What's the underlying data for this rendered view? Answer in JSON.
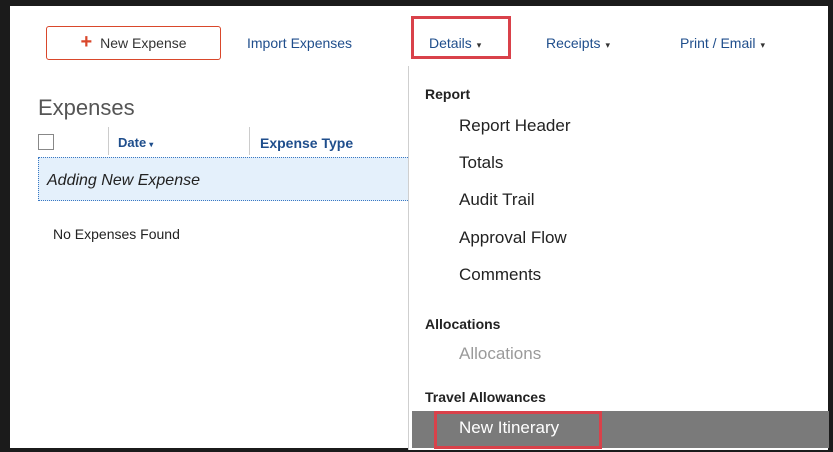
{
  "toolbar": {
    "new_expense_label": "New Expense",
    "new_expense_icon": "plus-icon",
    "import_label": "Import Expenses",
    "details_label": "Details",
    "receipts_label": "Receipts",
    "print_email_label": "Print / Email",
    "caret_glyph": "▾"
  },
  "expenses": {
    "title": "Expenses",
    "columns": {
      "date": "Date",
      "expense_type": "Expense Type"
    },
    "adding_row": "Adding New Expense",
    "empty_message": "No Expenses Found"
  },
  "details_menu": {
    "sections": [
      {
        "label": "Report",
        "items": [
          "Report Header",
          "Totals",
          "Audit Trail",
          "Approval Flow",
          "Comments"
        ]
      },
      {
        "label": "Allocations",
        "items": [
          "Allocations"
        ]
      },
      {
        "label": "Travel Allowances",
        "items": [
          "New Itinerary"
        ]
      }
    ]
  },
  "colors": {
    "accent_red": "#d9472b",
    "highlight_red": "#d9414a",
    "link_blue": "#1f4e8c",
    "selected_row_bg": "#7a7a7a",
    "adding_row_bg": "#e4f0fb"
  }
}
